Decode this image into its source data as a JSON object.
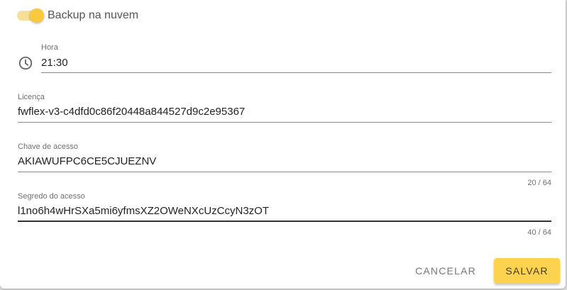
{
  "backup": {
    "label": "Backup na nuvem",
    "enabled": true
  },
  "hora": {
    "label": "Hora",
    "value": "21:30",
    "icon": "clock-icon"
  },
  "licenca": {
    "label": "Licença",
    "value": "fwflex-v3-c4dfd0c86f20448a844527d9c2e95367"
  },
  "chave": {
    "label": "Chave de acesso",
    "value": "AKIAWUFPC6CE5CJUEZNV",
    "counter": "20 / 64"
  },
  "segredo": {
    "label": "Segredo do acesso",
    "value": "l1no6h4wHrSXa5mi6yfmsXZ2OWeNXcUzCcyN3zOT",
    "counter": "40 / 64"
  },
  "actions": {
    "cancel_label": "CANCELAR",
    "save_label": "SALVAR"
  },
  "colors": {
    "accent": "#fbc93d",
    "accent_track": "#f6df96",
    "save_button": "#fbd34f"
  }
}
